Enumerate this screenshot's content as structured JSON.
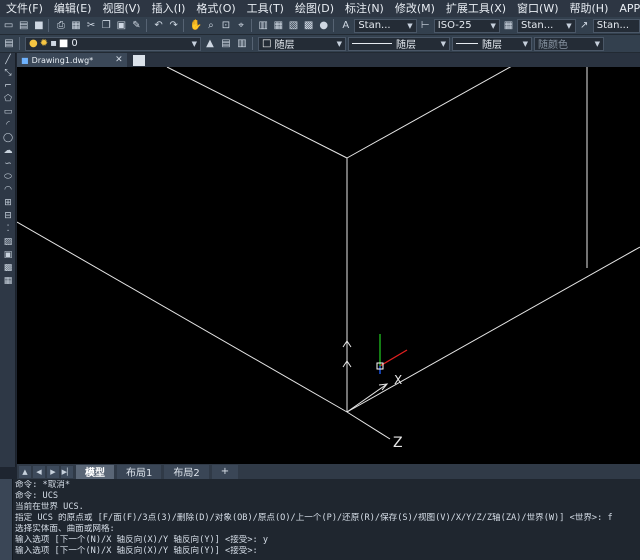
{
  "menu": [
    {
      "label": "文件(F)"
    },
    {
      "label": "编辑(E)"
    },
    {
      "label": "视图(V)"
    },
    {
      "label": "插入(I)"
    },
    {
      "label": "格式(O)"
    },
    {
      "label": "工具(T)"
    },
    {
      "label": "绘图(D)"
    },
    {
      "label": "标注(N)"
    },
    {
      "label": "修改(M)"
    },
    {
      "label": "扩展工具(X)"
    },
    {
      "label": "窗口(W)"
    },
    {
      "label": "帮助(H)"
    },
    {
      "label": "APP+"
    }
  ],
  "toolbar": {
    "text_style": "Stan...",
    "dim_style": "ISO-25",
    "table_style": "Stan...",
    "multileader_style": "Stan...",
    "layer": "0",
    "color": "随层",
    "linetype": "随层",
    "lineweight": "随层",
    "plot_style": "随颜色"
  },
  "document_tab": {
    "label": "Drawing1.dwg*"
  },
  "canvas": {
    "ucs_x_label": "X",
    "ucs_z_label": "Z",
    "colors": {
      "background": "#000000",
      "lines": "#e6e6e6",
      "x_axis": "#e02020",
      "y_axis": "#20c020",
      "z_axis": "#2060ff"
    }
  },
  "layout_tabs": [
    {
      "label": "模型",
      "active": true
    },
    {
      "label": "布局1",
      "active": false
    },
    {
      "label": "布局2",
      "active": false
    },
    {
      "label": "+",
      "active": false
    }
  ],
  "command_history": [
    "命令: *取消*",
    "命令: UCS",
    "当前在世界 UCS.",
    "指定 UCS 的原点或 [F/面(F)/3点(3)/删除(D)/对象(OB)/原点(O)/上一个(P)/还原(R)/保存(S)/视图(V)/X/Y/Z/Z轴(ZA)/世界(W)] <世界>: f",
    "选择实体面、曲面或网格:",
    "输入选项 [下一个(N)/X 轴反向(X)/Y 轴反向(Y)] <接受>: y",
    "输入选项 [下一个(N)/X 轴反向(X)/Y 轴反向(Y)] <接受>:"
  ]
}
